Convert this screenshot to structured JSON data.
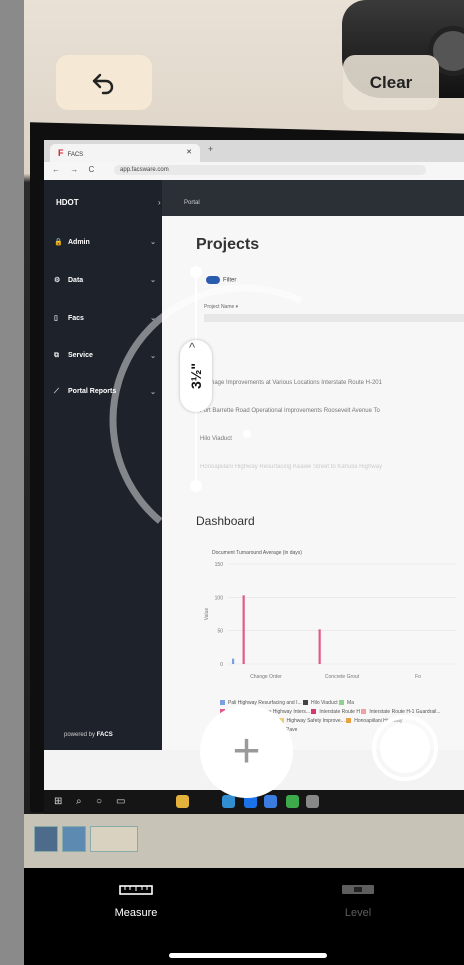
{
  "toolbar": {
    "undo_icon": "undo-arrow-icon",
    "clear_label": "Clear"
  },
  "measurement": {
    "value": "3½\""
  },
  "bottom_tabs": [
    {
      "label": "Measure",
      "icon": "ruler-icon",
      "selected": true
    },
    {
      "label": "Level",
      "icon": "level-icon",
      "selected": false
    }
  ],
  "camera_view": {
    "browser": {
      "tab_title": "FACS",
      "url": "app.facsware.com"
    },
    "app": {
      "brand": "HDOT",
      "breadcrumb": "Portal",
      "sidebar_items": [
        "Admin",
        "Data",
        "Facs",
        "Service",
        "Portal Reports"
      ],
      "powered_by": "powered by",
      "powered_by_brand": "FACS",
      "projects_title": "Projects",
      "filter_label": "Filter",
      "project_name_label": "Project Name ▾",
      "project_rows": [
        "Drainage Improvements at Various Locations Interstate Route H-201",
        "Fort Barrette Road Operational Improvements Roosevelt Avenue To",
        "Hilo Viaduct",
        "Honoapiilani Highway Resurfacing Keawe Street to Kahului Highway"
      ],
      "dashboard_title": "Dashboard"
    },
    "chart_data": {
      "type": "bar",
      "title": "Document Turnaround Average (in days)",
      "ylabel": "Value",
      "ylim": [
        0,
        150
      ],
      "yticks": [
        0,
        50,
        100,
        150
      ],
      "categories": [
        "Change Order",
        "Concrete Grout",
        "Fo"
      ],
      "series": [
        {
          "name": "Pali Highway Resurfacing and I...",
          "color": "#7aa0e0",
          "values": [
            8,
            0,
            0
          ]
        },
        {
          "name": "Hilo Viaduct",
          "color": "#444444",
          "values": [
            0,
            0,
            0
          ]
        },
        {
          "name": "Ma",
          "color": "#8fd18f",
          "values": [
            0,
            0,
            0
          ]
        },
        {
          "name": "Queen Kaahumanu Highway Inters...",
          "color": "#e05a8a",
          "values": [
            103,
            52,
            0
          ]
        },
        {
          "name": "Interstate Route H",
          "color": "#d23a6a",
          "values": [
            0,
            0,
            0
          ]
        },
        {
          "name": "Interstate Route H-1 Guardrail...",
          "color": "#f0a0a0",
          "values": [
            0,
            0,
            0
          ]
        },
        {
          "name": "Report Testing Project",
          "color": "#9ad0f0",
          "values": [
            0,
            0,
            0
          ]
        },
        {
          "name": "Highway Safety Improve...",
          "color": "#e8d070",
          "values": [
            0,
            0,
            0
          ]
        },
        {
          "name": "Honoapiilani Highway",
          "color": "#e8a040",
          "values": [
            0,
            0,
            0
          ]
        },
        {
          "name": "Short-Term Impro...",
          "color": "#b0b0b0",
          "values": [
            0,
            0,
            0
          ]
        },
        {
          "name": "of Pave",
          "color": "#c8b070",
          "values": [
            0,
            0,
            0
          ]
        }
      ],
      "legend_position": "bottom"
    }
  }
}
